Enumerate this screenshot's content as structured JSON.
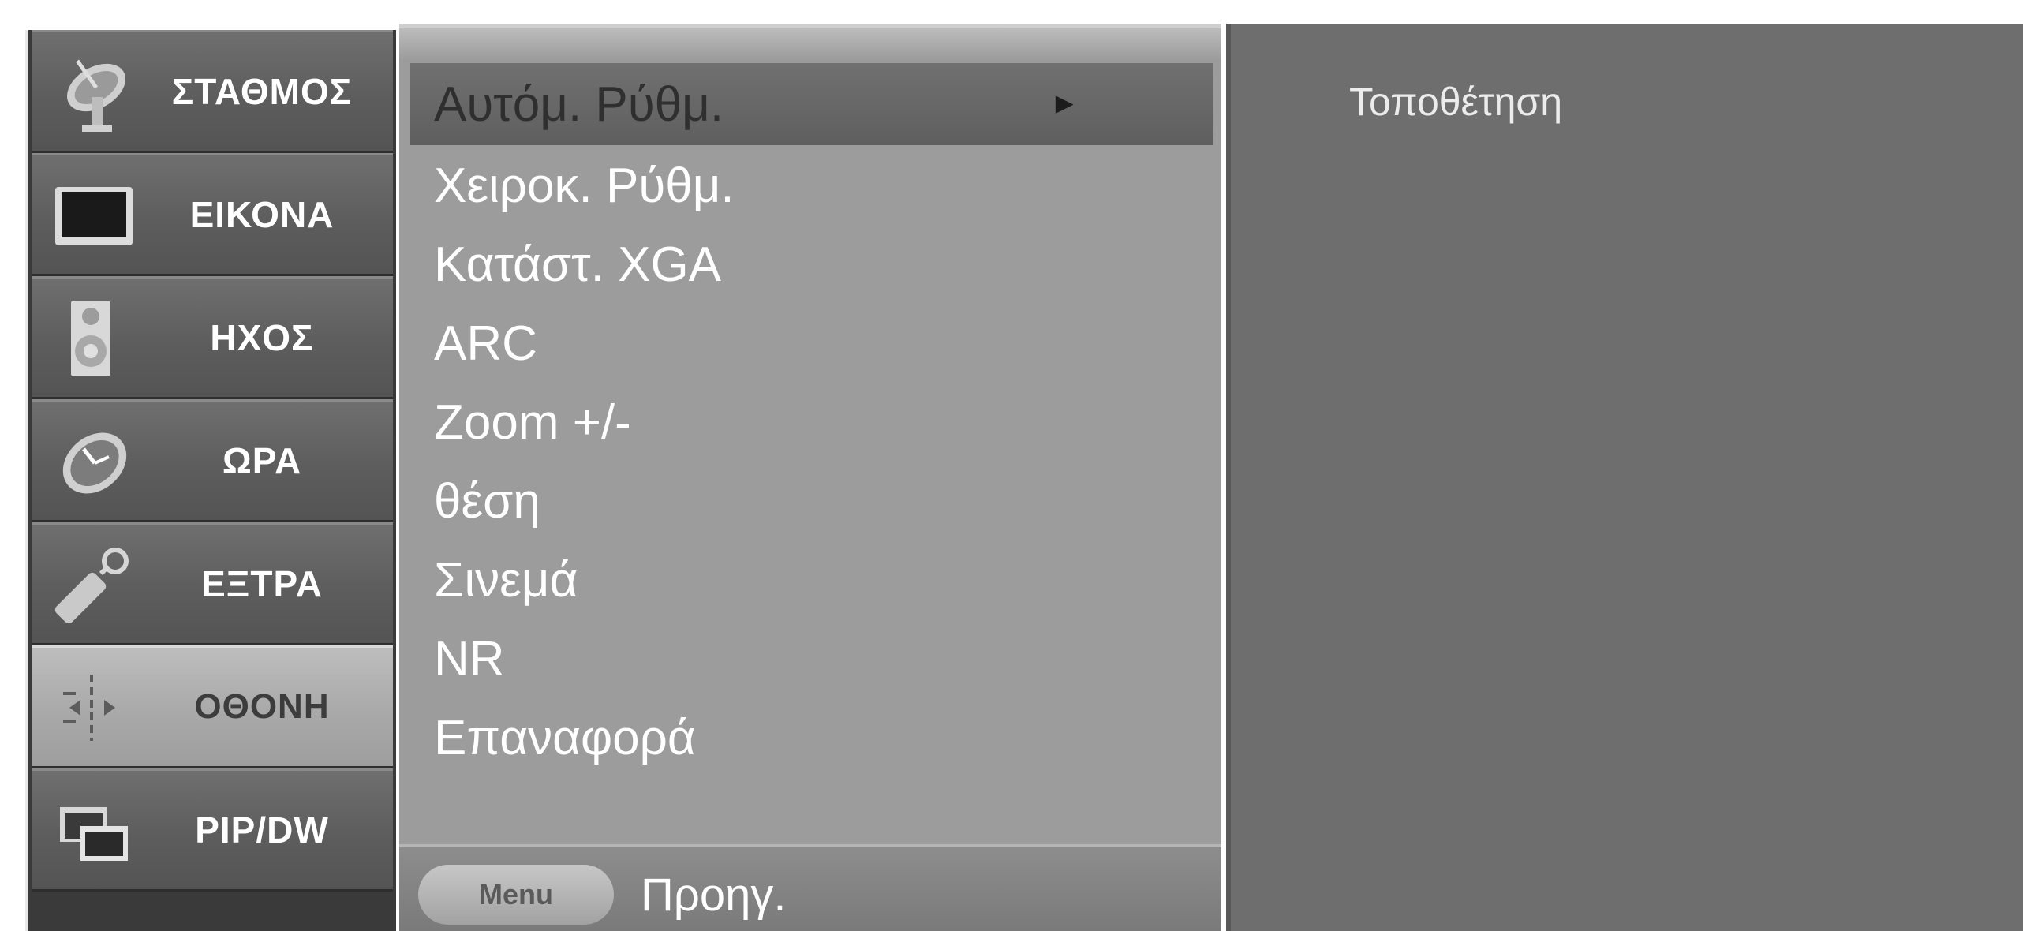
{
  "categories": [
    {
      "label": "ΣΤΑΘΜΟΣ",
      "icon": "satellite-dish-icon",
      "selected": false
    },
    {
      "label": "ΕΙΚΟΝΑ",
      "icon": "tv-screen-icon",
      "selected": false
    },
    {
      "label": "ΗΧΟΣ",
      "icon": "speaker-icon",
      "selected": false
    },
    {
      "label": "ΩΡΑ",
      "icon": "clock-icon",
      "selected": false
    },
    {
      "label": "ΕΞΤΡΑ",
      "icon": "key-tag-icon",
      "selected": false
    },
    {
      "label": "ΟΘΟΝΗ",
      "icon": "screen-adjust-icon",
      "selected": true
    },
    {
      "label": "PIP/DW",
      "icon": "pip-windows-icon",
      "selected": false
    }
  ],
  "submenu": {
    "items": [
      {
        "label": "Αυτόμ. Ρύθμ.",
        "selected": true,
        "has_submenu": true
      },
      {
        "label": "Χειροκ. Ρύθμ.",
        "selected": false
      },
      {
        "label": "Κατάστ. XGA",
        "selected": false
      },
      {
        "label": "ARC",
        "selected": false
      },
      {
        "label": "Zoom +/-",
        "selected": false
      },
      {
        "label": "θέση",
        "selected": false
      },
      {
        "label": "Σινεμά",
        "selected": false
      },
      {
        "label": "NR",
        "selected": false
      },
      {
        "label": "Επαναφορά",
        "selected": false
      }
    ],
    "arrow_glyph": "►",
    "footer": {
      "menu_button": "Menu",
      "back_label": "Προηγ."
    }
  },
  "info_panel": {
    "text": "Τοποθέτηση"
  },
  "colors": {
    "category_bg": "#5d5d5d",
    "category_selected_bg": "#a9a9a9",
    "submenu_bg": "#9c9c9c",
    "submenu_selected_bg": "#666666",
    "info_panel_bg": "#6e6e6e"
  }
}
